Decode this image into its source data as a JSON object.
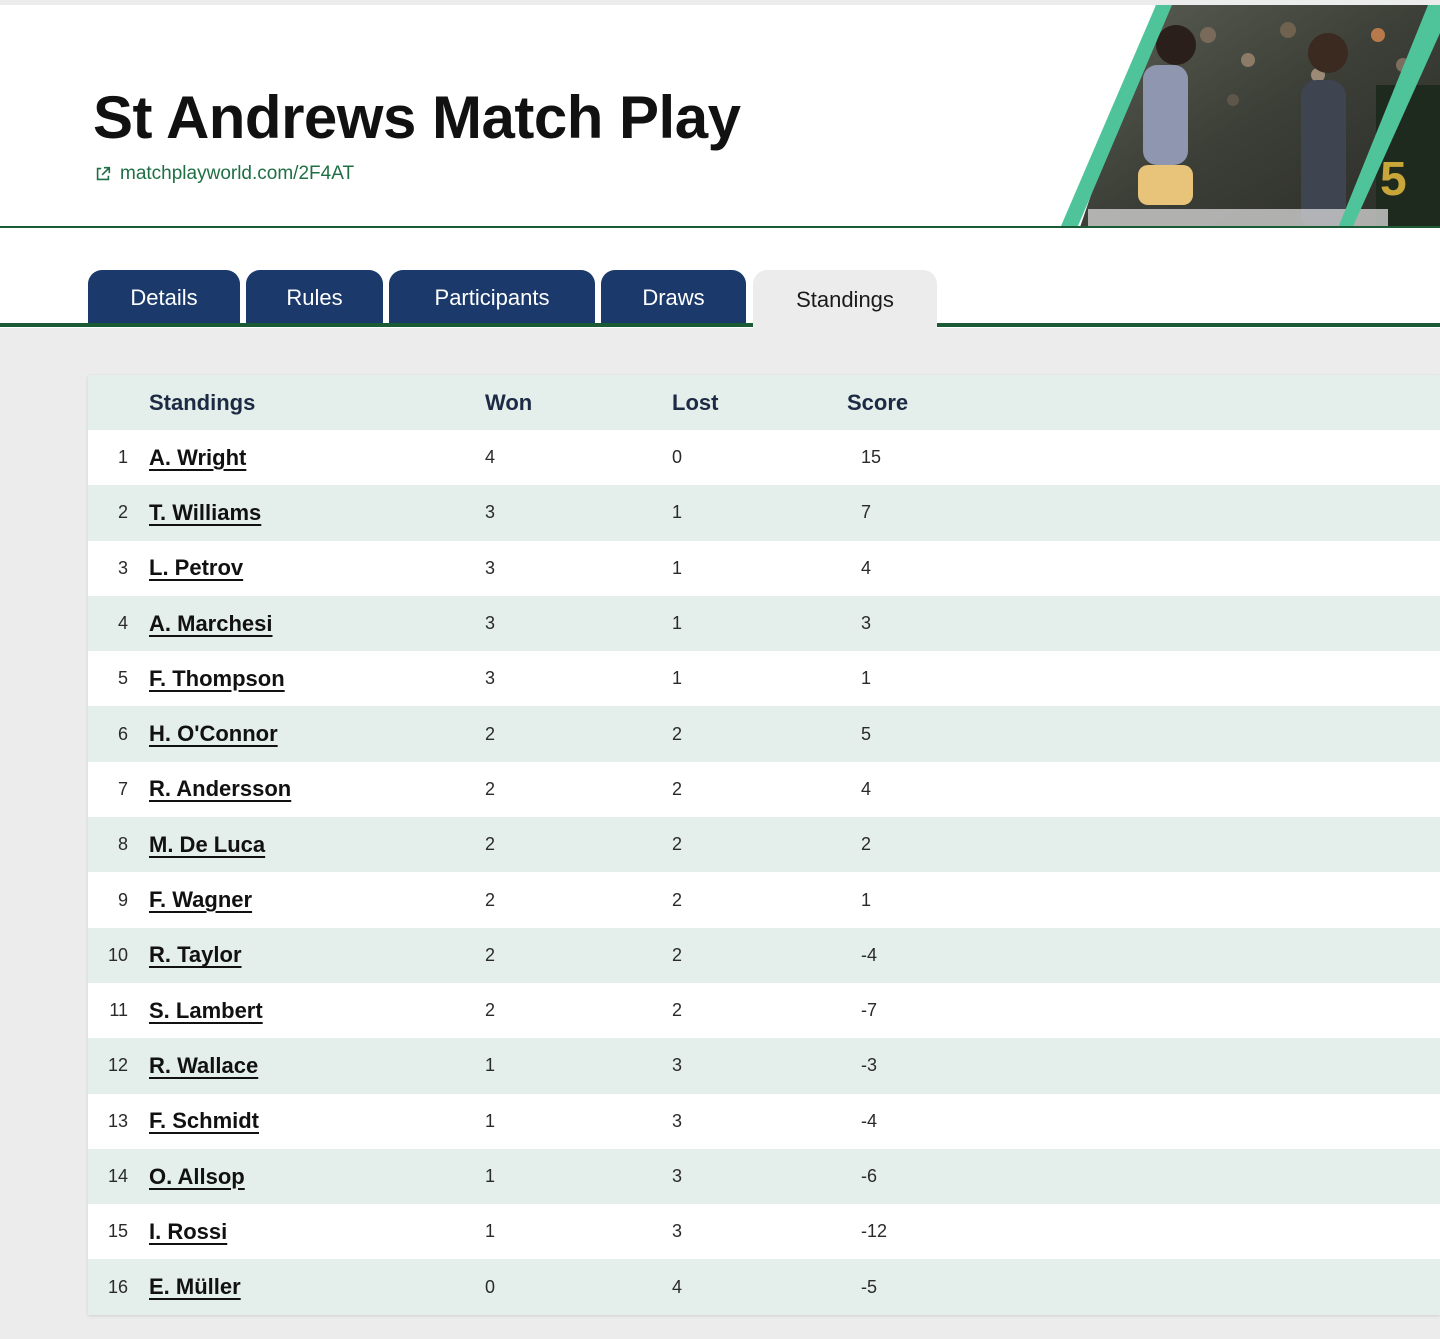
{
  "header": {
    "title": "St Andrews Match Play",
    "link_text": "matchplayworld.com/2F4AT"
  },
  "tabs": [
    {
      "label": "Details",
      "active": false
    },
    {
      "label": "Rules",
      "active": false
    },
    {
      "label": "Participants",
      "active": false
    },
    {
      "label": "Draws",
      "active": false
    },
    {
      "label": "Standings",
      "active": true
    }
  ],
  "colors": {
    "brand_green": "#1a5b35",
    "tab_navy": "#1b3a6b",
    "row_tint": "#e4eeea",
    "accent_teal": "#4fc49b"
  },
  "table": {
    "columns": [
      "Standings",
      "Won",
      "Lost",
      "Score"
    ],
    "rows": [
      {
        "rank": "1",
        "name": "A. Wright",
        "won": "4",
        "lost": "0",
        "score": "15"
      },
      {
        "rank": "2",
        "name": "T. Williams",
        "won": "3",
        "lost": "1",
        "score": "7"
      },
      {
        "rank": "3",
        "name": "L. Petrov",
        "won": "3",
        "lost": "1",
        "score": "4"
      },
      {
        "rank": "4",
        "name": "A. Marchesi",
        "won": "3",
        "lost": "1",
        "score": "3"
      },
      {
        "rank": "5",
        "name": "F. Thompson",
        "won": "3",
        "lost": "1",
        "score": "1"
      },
      {
        "rank": "6",
        "name": "H. O'Connor",
        "won": "2",
        "lost": "2",
        "score": "5"
      },
      {
        "rank": "7",
        "name": "R. Andersson",
        "won": "2",
        "lost": "2",
        "score": "4"
      },
      {
        "rank": "8",
        "name": "M. De Luca",
        "won": "2",
        "lost": "2",
        "score": "2"
      },
      {
        "rank": "9",
        "name": "F. Wagner",
        "won": "2",
        "lost": "2",
        "score": "1"
      },
      {
        "rank": "10",
        "name": "R. Taylor",
        "won": "2",
        "lost": "2",
        "score": "-4"
      },
      {
        "rank": "11",
        "name": "S. Lambert",
        "won": "2",
        "lost": "2",
        "score": "-7"
      },
      {
        "rank": "12",
        "name": "R. Wallace",
        "won": "1",
        "lost": "3",
        "score": "-3"
      },
      {
        "rank": "13",
        "name": "F. Schmidt",
        "won": "1",
        "lost": "3",
        "score": "-4"
      },
      {
        "rank": "14",
        "name": "O. Allsop",
        "won": "1",
        "lost": "3",
        "score": "-6"
      },
      {
        "rank": "15",
        "name": "I. Rossi",
        "won": "1",
        "lost": "3",
        "score": "-12"
      },
      {
        "rank": "16",
        "name": "E. Müller",
        "won": "0",
        "lost": "4",
        "score": "-5"
      }
    ]
  }
}
